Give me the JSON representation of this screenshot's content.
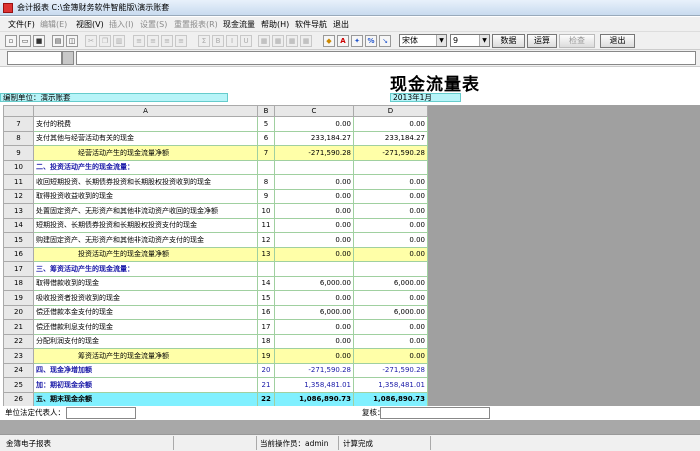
{
  "window": {
    "title": "会计报表  C:\\金簿财务软件智能版\\演示账套"
  },
  "menu": [
    {
      "label": "文件(F)",
      "enabled": true
    },
    {
      "label": "编辑(E)",
      "enabled": false
    },
    {
      "label": "视图(V)",
      "enabled": true
    },
    {
      "label": "插入(I)",
      "enabled": false
    },
    {
      "label": "设置(S)",
      "enabled": false
    },
    {
      "label": "重置报表(R)",
      "enabled": false
    },
    {
      "label": "现金流量",
      "enabled": true
    },
    {
      "label": "帮助(H)",
      "enabled": true
    },
    {
      "label": "软件导航",
      "enabled": true
    },
    {
      "label": "退出",
      "enabled": true
    }
  ],
  "toolbar": {
    "font_name": "宋体",
    "font_size": "9",
    "data_label": "数据",
    "calc_label": "运算",
    "check_label": "检查",
    "exit_label": "退出",
    "sigma": "Σ",
    "bold": "B",
    "italic": "I",
    "underline": "U",
    "percent": "%"
  },
  "report": {
    "title": "现金流量表",
    "unit_label": "编制单位：演示账套",
    "date_label": "2013年1月",
    "columns": {
      "a": "A",
      "b": "B",
      "c": "C",
      "d": "D"
    },
    "rows": [
      {
        "rn": "7",
        "a": "支付的税费",
        "b": "5",
        "c": "0.00",
        "d": "0.00",
        "style": "",
        "indent": false
      },
      {
        "rn": "8",
        "a": "支付其他与经营活动有关的现金",
        "b": "6",
        "c": "233,184.27",
        "d": "233,184.27",
        "style": "",
        "indent": false
      },
      {
        "rn": "9",
        "a": "经营活动产生的现金流量净额",
        "b": "7",
        "c": "-271,590.28",
        "d": "-271,590.28",
        "style": "yl",
        "indent": true
      },
      {
        "rn": "10",
        "a": "二、投资活动产生的现金流量：",
        "b": "",
        "c": "",
        "d": "",
        "style": "bl",
        "indent": false
      },
      {
        "rn": "11",
        "a": "收回短期投资、长期债券投资和长期股权投资收到的现金",
        "b": "8",
        "c": "0.00",
        "d": "0.00",
        "style": "",
        "indent": false
      },
      {
        "rn": "12",
        "a": "取得投资收益收到的现金",
        "b": "9",
        "c": "0.00",
        "d": "0.00",
        "style": "",
        "indent": false
      },
      {
        "rn": "13",
        "a": "处置固定资产、无形资产和其他非流动资产收回的现金净额",
        "b": "10",
        "c": "0.00",
        "d": "0.00",
        "style": "",
        "indent": false
      },
      {
        "rn": "14",
        "a": "短期投资、长期债券投资和长期股权投资支付的现金",
        "b": "11",
        "c": "0.00",
        "d": "0.00",
        "style": "",
        "indent": false
      },
      {
        "rn": "15",
        "a": "购建固定资产、无形资产和其他非流动资产支付的现金",
        "b": "12",
        "c": "0.00",
        "d": "0.00",
        "style": "",
        "indent": false
      },
      {
        "rn": "16",
        "a": "投资活动产生的现金流量净额",
        "b": "13",
        "c": "0.00",
        "d": "0.00",
        "style": "yl",
        "indent": true
      },
      {
        "rn": "17",
        "a": "三、筹资活动产生的现金流量：",
        "b": "",
        "c": "",
        "d": "",
        "style": "bl",
        "indent": false
      },
      {
        "rn": "18",
        "a": "取得借款收到的现金",
        "b": "14",
        "c": "6,000.00",
        "d": "6,000.00",
        "style": "",
        "indent": false
      },
      {
        "rn": "19",
        "a": "吸收投资者投资收到的现金",
        "b": "15",
        "c": "0.00",
        "d": "0.00",
        "style": "",
        "indent": false
      },
      {
        "rn": "20",
        "a": "偿还借款本金支付的现金",
        "b": "16",
        "c": "6,000.00",
        "d": "6,000.00",
        "style": "",
        "indent": false
      },
      {
        "rn": "21",
        "a": "偿还借款利息支付的现金",
        "b": "17",
        "c": "0.00",
        "d": "0.00",
        "style": "",
        "indent": false
      },
      {
        "rn": "22",
        "a": "分配利润支付的现金",
        "b": "18",
        "c": "0.00",
        "d": "0.00",
        "style": "",
        "indent": false
      },
      {
        "rn": "23",
        "a": "筹资活动产生的现金流量净额",
        "b": "19",
        "c": "0.00",
        "d": "0.00",
        "style": "yl",
        "indent": true
      },
      {
        "rn": "24",
        "a": "四、现金净增加额",
        "b": "20",
        "c": "-271,590.28",
        "d": "-271,590.28",
        "style": "bl2",
        "indent": false
      },
      {
        "rn": "25",
        "a": "加：期初现金余额",
        "b": "21",
        "c": "1,358,481.01",
        "d": "1,358,481.01",
        "style": "bl2",
        "indent": false
      },
      {
        "rn": "26",
        "a": "五、期末现金余额",
        "b": "22",
        "c": "1,086,890.73",
        "d": "1,086,890.73",
        "style": "cy",
        "indent": false
      }
    ],
    "legal_rep_label": "单位法定代表人：",
    "reviewer_label": "复核："
  },
  "status": {
    "app": "金簿电子报表",
    "operator": "当前操作员：admin",
    "state": "计算完成"
  }
}
